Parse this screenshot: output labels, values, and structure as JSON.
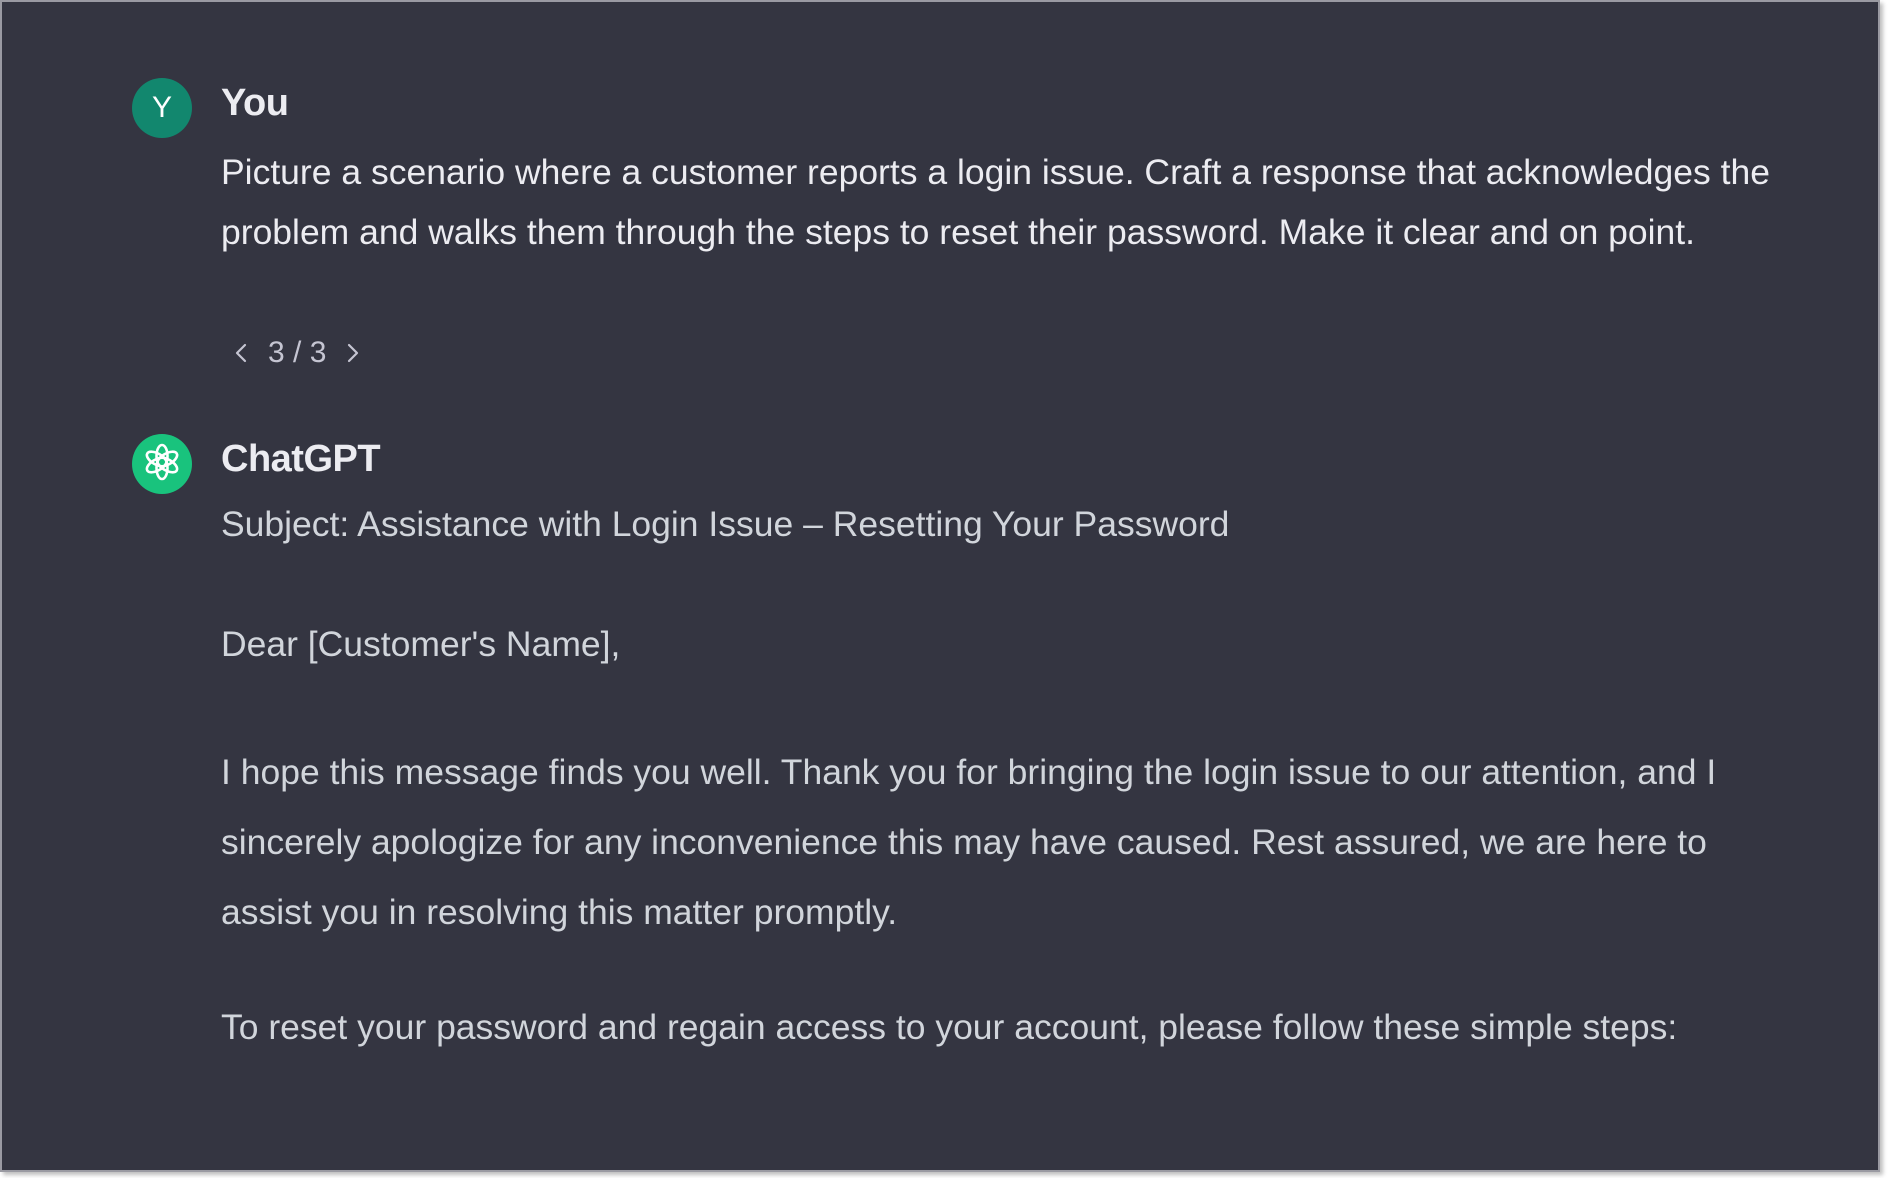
{
  "user_message": {
    "avatar_letter": "Y",
    "author": "You",
    "text": "Picture a scenario where a customer reports a login issue. Craft a response that acknowledges the problem and walks them through the steps to reset their password. Make it clear and on point.",
    "pager": {
      "label": "3 / 3",
      "prev_icon": "chevron-left-icon",
      "next_icon": "chevron-right-icon"
    }
  },
  "assistant_message": {
    "author": "ChatGPT",
    "avatar_icon": "openai-logo-icon",
    "subject": "Subject: Assistance with Login Issue – Resetting Your Password",
    "greeting": "Dear [Customer's Name],",
    "paragraph_1": "I hope this message finds you well. Thank you for bringing the login issue to our attention, and I sincerely apologize for any inconvenience this may have caused. Rest assured, we are here to assist you in resolving this matter promptly.",
    "paragraph_2": "To reset your password and regain access to your account, please follow these simple steps:"
  },
  "colors": {
    "background": "#343541",
    "user_avatar": "#12876e",
    "assistant_avatar": "#19c37d",
    "text_primary": "#ececf1",
    "text_secondary": "#d1d5db"
  }
}
